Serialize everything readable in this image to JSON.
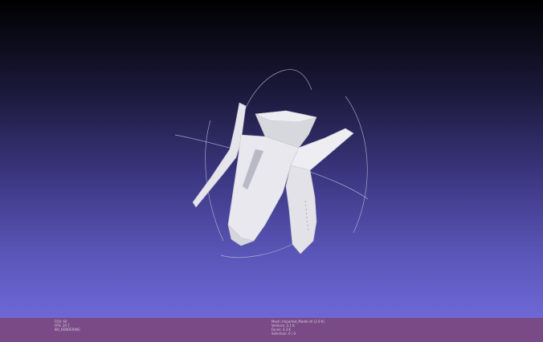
{
  "app": "MeshLab 3D viewer",
  "viewport": {
    "background_top": "#000000",
    "background_bottom": "#6e68d6",
    "model_color": "#e9e9ee",
    "trackball_color": "#b8b8d8"
  },
  "status_left": [
    "FOV: 60",
    "FPS: 29.7",
    "BO_RENDERING"
  ],
  "status_right": [
    "Mesh: Imported_Model.stl (2.9 K)",
    "Vertices: 2.1 K",
    "Faces: 4.3 K",
    "Selection: 0 / 0"
  ],
  "statusbar_color": "#7a4a86"
}
